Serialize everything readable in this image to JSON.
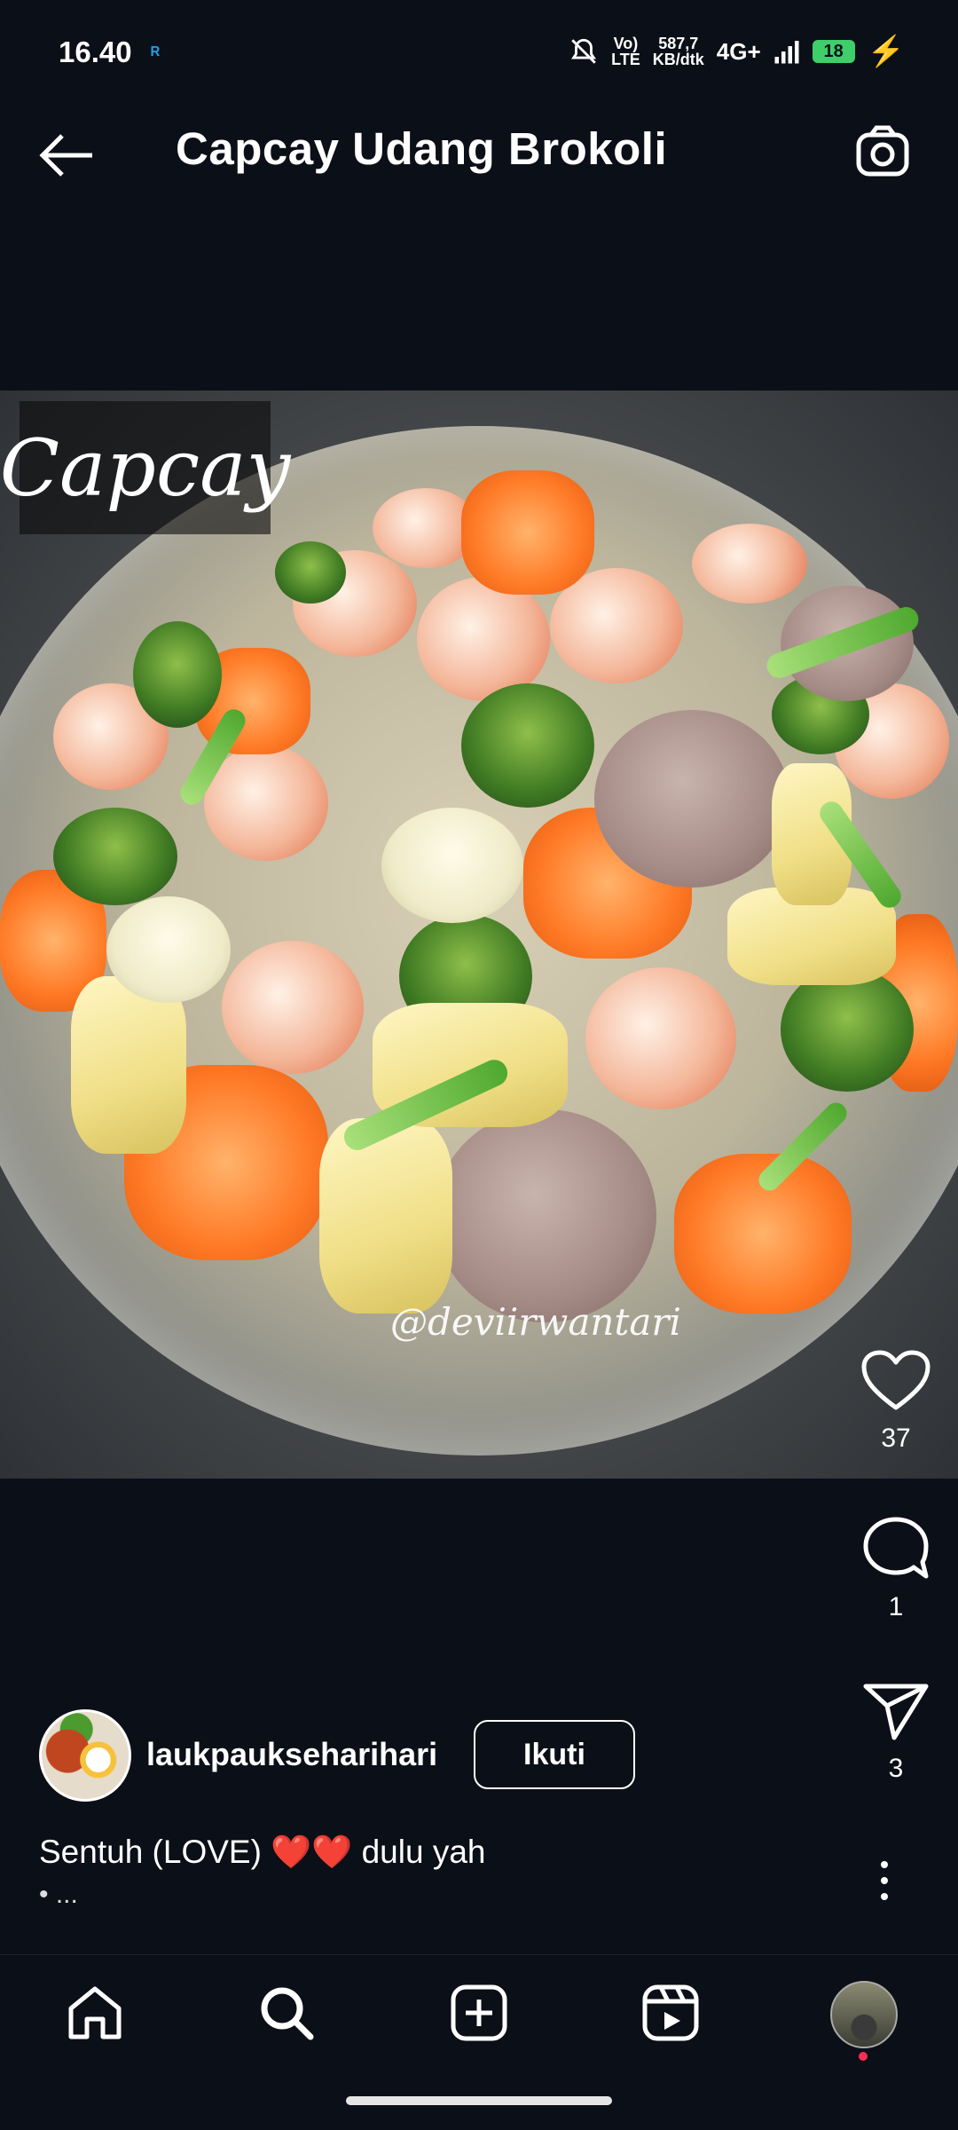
{
  "status_bar": {
    "time": "16.40",
    "network_speed_top": "587,7",
    "network_speed_bottom": "KB/dtk",
    "volte_top": "Vo)",
    "volte_bottom": "LTE",
    "network_type": "4G+",
    "battery_level": "18",
    "icons": [
      "r-app-icon",
      "mute-bell-icon",
      "signal-icon",
      "battery-icon",
      "charging-bolt-icon"
    ]
  },
  "header": {
    "title": "Capcay Udang Brokoli"
  },
  "post_image": {
    "overlay_label": "Capcay",
    "watermark": "@deviirwantari"
  },
  "actions": {
    "likes": "37",
    "comments": "1",
    "shares": "3"
  },
  "post": {
    "username": "laukpaukseharihari",
    "follow_label": "Ikuti",
    "caption": "Sentuh (LOVE) ❤️❤️ dulu yah",
    "caption_more": "• ..."
  },
  "colors": {
    "background": "#0b0f17",
    "battery": "#3ecf6b",
    "notification_dot": "#ff2d55"
  }
}
